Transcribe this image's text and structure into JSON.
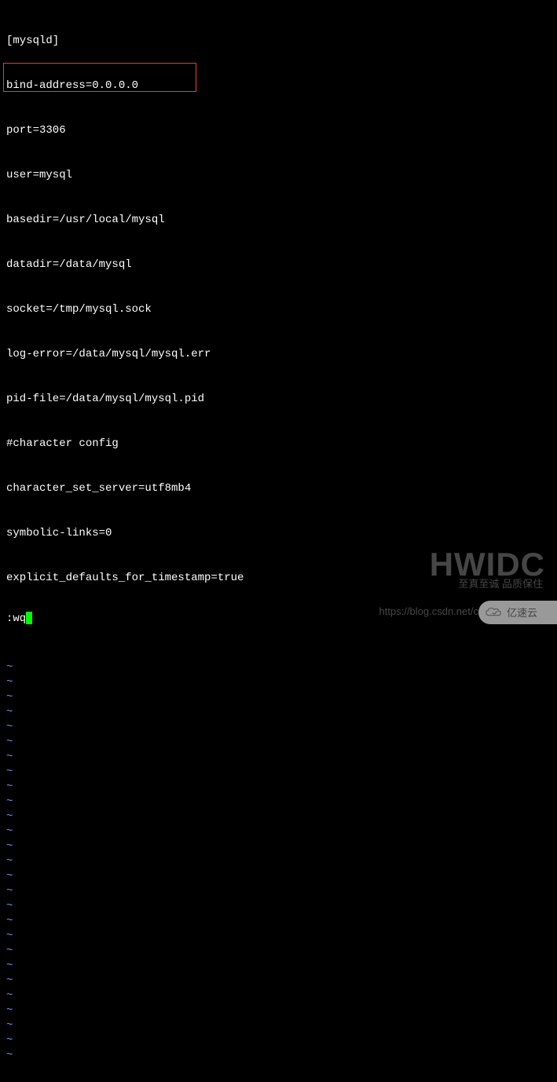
{
  "config_lines": [
    "[mysqld]",
    "bind-address=0.0.0.0",
    "port=3306",
    "user=mysql",
    "basedir=/usr/local/mysql",
    "datadir=/data/mysql",
    "socket=/tmp/mysql.sock",
    "log-error=/data/mysql/mysql.err",
    "pid-file=/data/mysql/mysql.pid",
    "#character config",
    "character_set_server=utf8mb4",
    "symbolic-links=0",
    "explicit_defaults_for_timestamp=true"
  ],
  "tilde": "~",
  "tilde_count": 27,
  "command": ":wq",
  "watermark": {
    "main": "HWIDC",
    "sub": "至真至诚 品质保住",
    "url": "https://blog.csdn.net/c",
    "badge_text": "亿速云"
  }
}
